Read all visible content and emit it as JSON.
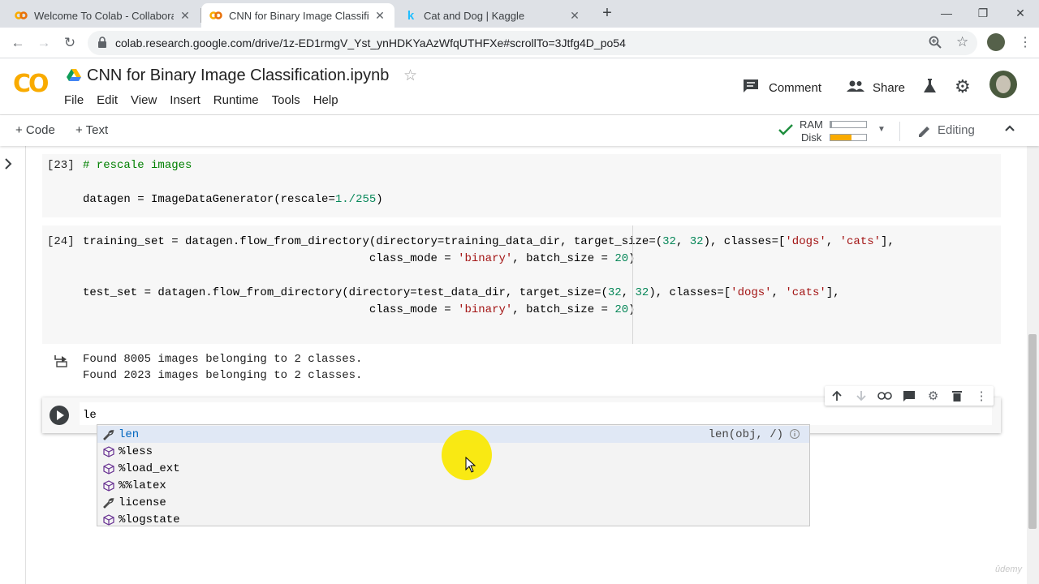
{
  "browser": {
    "tabs": [
      {
        "title": "Welcome To Colab - Collaborator",
        "favicon": "colab-icon"
      },
      {
        "title": "CNN for Binary Image Classificati",
        "favicon": "colab-icon",
        "active": true
      },
      {
        "title": "Cat and Dog | Kaggle",
        "favicon": "kaggle-icon"
      }
    ],
    "url": "colab.research.google.com/drive/1z-ED1rmgV_Yst_ynHDKYaAzWfqUTHFXe#scrollTo=3Jtfg4D_po54"
  },
  "colab": {
    "logo": "CO",
    "notebook_title": "CNN for Binary Image Classification.ipynb",
    "menu": [
      "File",
      "Edit",
      "View",
      "Insert",
      "Runtime",
      "Tools",
      "Help"
    ],
    "comment_label": "Comment",
    "share_label": "Share",
    "toolbar": {
      "add_code": "+ Code",
      "add_text": "+ Text",
      "ram_label": "RAM",
      "disk_label": "Disk",
      "ram_usage": 0.05,
      "disk_usage": 0.6,
      "editing_label": "Editing"
    }
  },
  "cells": {
    "c23": {
      "prompt": "[23]",
      "line1": "# rescale images",
      "line2_a": "datagen = ImageDataGenerator(rescale=",
      "line2_b": "1./255",
      "line2_c": ")"
    },
    "c24": {
      "prompt": "[24]",
      "l1_a": "training_set = datagen.flow_from_directory(directory=training_data_dir, target_size=(",
      "l1_n1": "32",
      "l1_b": ", ",
      "l1_n2": "32",
      "l1_c": "), classes=[",
      "l1_s1": "'dogs'",
      "l1_d": ", ",
      "l1_s2": "'cats'",
      "l1_e": "],",
      "l2_a": "                                          class_mode = ",
      "l2_s": "'binary'",
      "l2_b": ", batch_size = ",
      "l2_n": "20",
      "l2_c": ")",
      "l3_a": "test_set = datagen.flow_from_directory(directory=test_data_dir, target_size=(",
      "l3_n1": "32",
      "l3_b": ", ",
      "l3_n2": "32",
      "l3_c": "), classes=[",
      "l3_s1": "'dogs'",
      "l3_d": ", ",
      "l3_s2": "'cats'",
      "l3_e": "],",
      "l4_a": "                                          class_mode = ",
      "l4_s": "'binary'",
      "l4_b": ", batch_size = ",
      "l4_n": "20",
      "l4_c": ")",
      "output1": "Found 8005 images belonging to 2 classes.",
      "output2": "Found 2023 images belonging to 2 classes."
    },
    "active": {
      "text": "le"
    }
  },
  "autocomplete": {
    "items": [
      {
        "label": "len",
        "icon": "wrench-icon",
        "detail": "len(obj, /)"
      },
      {
        "label": "%less",
        "icon": "cube-icon"
      },
      {
        "label": "%load_ext",
        "icon": "cube-icon"
      },
      {
        "label": "%%latex",
        "icon": "cube-icon"
      },
      {
        "label": "license",
        "icon": "wrench-icon"
      },
      {
        "label": "%logstate",
        "icon": "cube-icon"
      }
    ]
  },
  "watermark": "ûdemy"
}
